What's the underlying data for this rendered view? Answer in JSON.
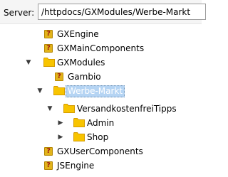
{
  "server": {
    "label": "Server:",
    "path": "/httpdocs/GXModules/Werbe-Markt"
  },
  "tree": {
    "rows": [
      {
        "label": "GXEngine",
        "icon": "unknown-file-icon",
        "twisty": ""
      },
      {
        "label": "GXMainComponents",
        "icon": "unknown-file-icon",
        "twisty": ""
      },
      {
        "label": "GXModules",
        "icon": "folder-icon",
        "twisty": "▼"
      },
      {
        "label": "Gambio",
        "icon": "unknown-file-icon",
        "twisty": ""
      },
      {
        "label": "Werbe-Markt",
        "icon": "folder-icon",
        "twisty": "▼",
        "selected": true
      },
      {
        "label": "VersandkostenfreiTipps",
        "icon": "folder-icon",
        "twisty": "▼"
      },
      {
        "label": "Admin",
        "icon": "folder-icon",
        "twisty": "▶"
      },
      {
        "label": "Shop",
        "icon": "folder-icon",
        "twisty": "▶"
      },
      {
        "label": "GXUserComponents",
        "icon": "unknown-file-icon",
        "twisty": ""
      },
      {
        "label": "JSEngine",
        "icon": "unknown-file-icon",
        "twisty": ""
      }
    ]
  },
  "colors": {
    "folder": "#f8c400",
    "folder_dark": "#d49b00",
    "unknown_bg": "#e2b41a",
    "unknown_fg": "#a11d13",
    "selection": "#b5d4f3"
  }
}
